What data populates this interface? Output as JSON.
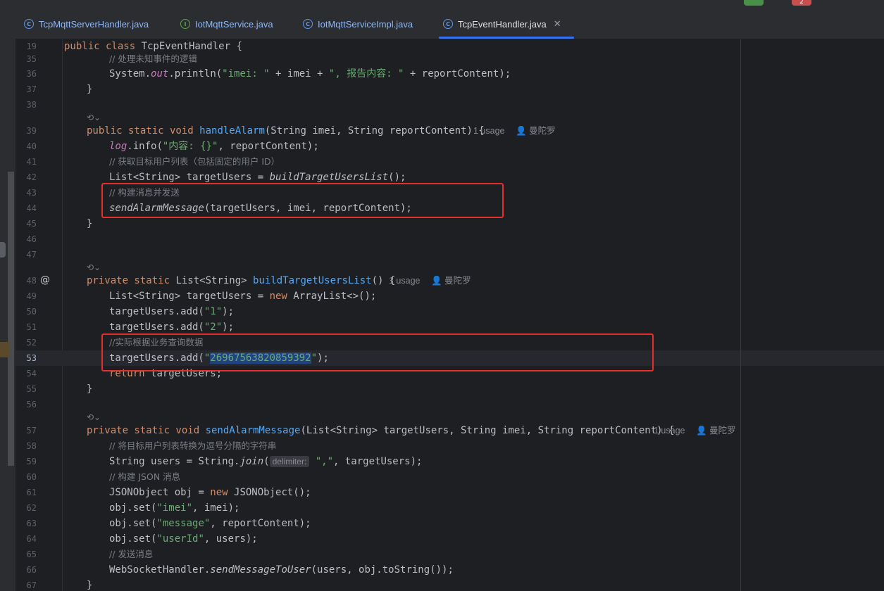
{
  "tabs": [
    {
      "label": "TcpMqttServerHandler.java",
      "icon": "class-icon",
      "active": false
    },
    {
      "label": "IotMqttService.java",
      "icon": "interface-icon",
      "active": false
    },
    {
      "label": "IotMqttServiceImpl.java",
      "icon": "class-icon",
      "active": false
    },
    {
      "label": "TcpEventHandler.java",
      "icon": "class-icon",
      "active": true
    }
  ],
  "top_badge_red": "2",
  "lines": {
    "l19": {
      "num": "19",
      "kw": "public class ",
      "name": "TcpEventHandler {"
    },
    "l35": {
      "num": "35",
      "comment": "// 处理未知事件的逻辑"
    },
    "l36": {
      "num": "36",
      "a": "System.",
      "field": "out",
      "b": ".println(",
      "s1": "\"imei: \"",
      "c": " + imei + ",
      "s2": "\", 报告内容: \"",
      "d": " + reportContent);"
    },
    "l37": {
      "num": "37",
      "text": "}"
    },
    "l38": {
      "num": "38"
    },
    "l39": {
      "num": "39",
      "kw": "public static void ",
      "fn": "handleAlarm",
      "rest": "(String imei, String reportContent) {",
      "usage": "1 usage",
      "author": "曼陀罗"
    },
    "l40": {
      "num": "40",
      "field": "log",
      "a": ".info(",
      "s": "\"内容: {}\"",
      "b": ", reportContent);"
    },
    "l41": {
      "num": "41",
      "comment": "// 获取目标用户列表（包括固定的用户 ID）"
    },
    "l42": {
      "num": "42",
      "a": "List<String> targetUsers = ",
      "it": "buildTargetUsersList",
      "b": "();"
    },
    "l43": {
      "num": "43",
      "comment": "// 构建消息并发送"
    },
    "l44": {
      "num": "44",
      "it": "sendAlarmMessage",
      "b": "(targetUsers, imei, reportContent);"
    },
    "l45": {
      "num": "45",
      "text": "}"
    },
    "l46": {
      "num": "46"
    },
    "l47": {
      "num": "47"
    },
    "l48": {
      "num": "48",
      "kw": "private static ",
      "a": "List<String> ",
      "fn": "buildTargetUsersList",
      "rest": "() {",
      "usage": "1 usage",
      "author": "曼陀罗",
      "gutter_icon": "@"
    },
    "l49": {
      "num": "49",
      "a": "List<String> targetUsers = ",
      "kw": "new ",
      "b": "ArrayList<>();"
    },
    "l50": {
      "num": "50",
      "a": "targetUsers.add(",
      "s": "\"1\"",
      "b": ");"
    },
    "l51": {
      "num": "51",
      "a": "targetUsers.add(",
      "s": "\"2\"",
      "b": ");"
    },
    "l52": {
      "num": "52",
      "comment": "//实际根据业务查询数据"
    },
    "l53": {
      "num": "53",
      "a": "targetUsers.add(",
      "q": "\"",
      "sel": "26967563820859392",
      "q2": "\"",
      "b": ");"
    },
    "l54": {
      "num": "54",
      "kw": "return ",
      "b": "targetUsers;"
    },
    "l55": {
      "num": "55",
      "text": "}"
    },
    "l56": {
      "num": "56"
    },
    "l57": {
      "num": "57",
      "kw": "private static void ",
      "fn": "sendAlarmMessage",
      "rest": "(List<String> targetUsers, String imei, String reportContent) {",
      "usage": "1 usage",
      "author": "曼陀罗"
    },
    "l58": {
      "num": "58",
      "comment": "// 将目标用户列表转换为逗号分隔的字符串"
    },
    "l59": {
      "num": "59",
      "a": "String users = String.",
      "it": "join",
      "b": "(",
      "hint": "delimiter:",
      "s": "\",\"",
      "c": ", targetUsers);"
    },
    "l60": {
      "num": "60",
      "comment": "// 构建 JSON 消息"
    },
    "l61": {
      "num": "61",
      "a": "JSONObject obj = ",
      "kw": "new ",
      "b": "JSONObject();"
    },
    "l62": {
      "num": "62",
      "a": "obj.set(",
      "s": "\"imei\"",
      "b": ", imei);"
    },
    "l63": {
      "num": "63",
      "a": "obj.set(",
      "s": "\"message\"",
      "b": ", reportContent);"
    },
    "l64": {
      "num": "64",
      "a": "obj.set(",
      "s": "\"userId\"",
      "b": ", users);"
    },
    "l65": {
      "num": "65",
      "comment": "// 发送消息"
    },
    "l66": {
      "num": "66",
      "a": "WebSocketHandler.",
      "it": "sendMessageToUser",
      "b": "(users, obj.toString());"
    },
    "l67": {
      "num": "67",
      "text": "}"
    }
  },
  "colors": {
    "keyword": "#cf8e6d",
    "method": "#56a8f5",
    "string": "#6aab73",
    "comment": "#7a7e85",
    "highlight_box": "#e62e2a",
    "selection": "#214283"
  }
}
